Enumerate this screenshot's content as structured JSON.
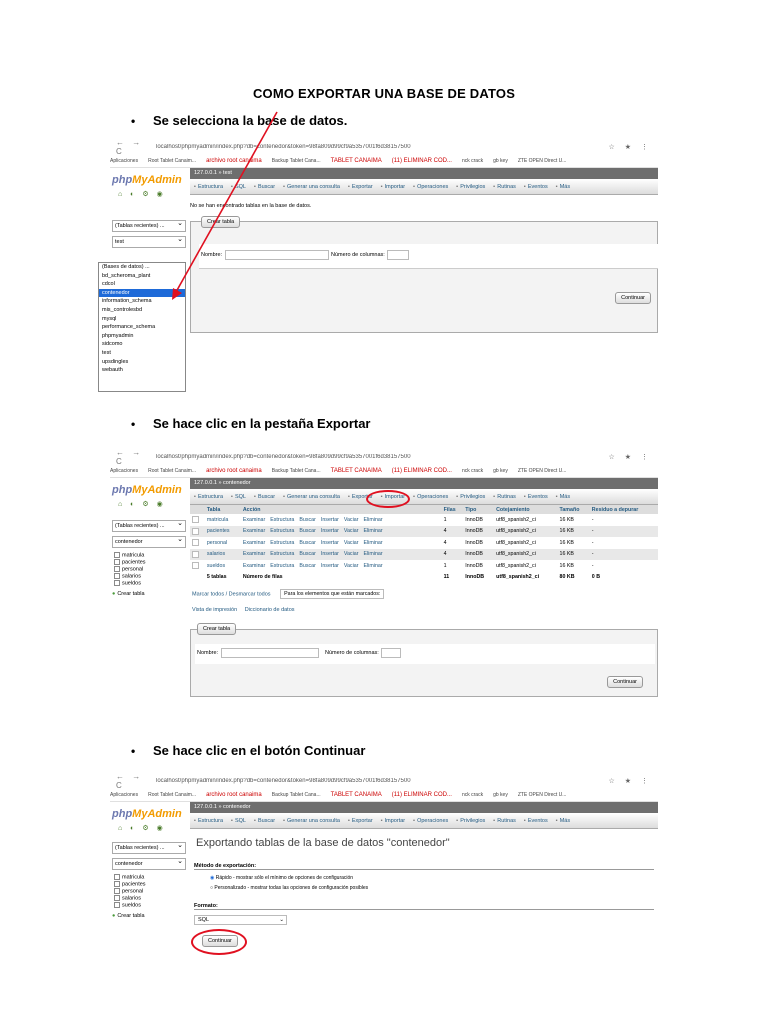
{
  "document": {
    "title": "COMO EXPORTAR UNA BASE DE DATOS",
    "steps": [
      "Se selecciona la base de datos.",
      "Se hace clic en la pestaña Exportar",
      "Se hace clic en el botón Continuar"
    ],
    "bullet": "•"
  },
  "browser": {
    "url1": "localhost/phpmyadmin/index.php?db=contenedor&token=98fa809d99cf9a5357001f6d38157500",
    "url2": "localhost/phpmyadmin/index.php?db=contenedor&token=98fa809d99cf9a5357001f6d38157500",
    "url3": "localhost/phpmyadmin/index.php?db=contenedor&token=98fa809d99cf9a5357001f6d38157500",
    "nav": "← → C",
    "tools": "☆ ★ ⋮",
    "bookmarks": [
      "Aplicaciones",
      "Root Tablet Canaim...",
      "archivo root canaima",
      "Backup Tablet Cana...",
      "TABLET CANAIMA",
      "(11) ELIMINAR COD...",
      "nck crack",
      "gb key",
      "ZTE OPEN Direct U..."
    ]
  },
  "pma": {
    "logo_php": "php",
    "logo_my": "MyAdmin",
    "recent": "(Tablas recientes) ...",
    "crumb1": "127.0.0.1 » test",
    "crumb2": "127.0.0.1 » contenedor",
    "tabs": [
      "Estructura",
      "SQL",
      "Buscar",
      "Generar una consulta",
      "Exportar",
      "Importar",
      "Operaciones",
      "Privilegios",
      "Rutinas",
      "Eventos",
      "Más"
    ],
    "db_selected_1": "test",
    "db_selected_2": "contenedor",
    "db_list": [
      "(Bases de datos) ...",
      "bd_scheroma_plant",
      "cdcol",
      "contenedor",
      "information_schema",
      "mis_controlesbd",
      "mysql",
      "performance_schema",
      "phpmyadmin",
      "sidcomo",
      "test",
      "upsdingles",
      "webauth"
    ],
    "db_list_selected": "contenedor",
    "tables": [
      "matricula",
      "pacientes",
      "personal",
      "salarios",
      "sueldos"
    ],
    "new_table": "Crear tabla",
    "no_tables": "No se han encontrado tablas en la base de datos.",
    "create_table_legend": "Crear tabla",
    "name_label": "Nombre:",
    "cols_label": "Número de columnas:",
    "continue_btn": "Continuar"
  },
  "shot2": {
    "headers": [
      "Tabla",
      "Acción",
      "Filas",
      "Tipo",
      "Cotejamiento",
      "Tamaño",
      "Residuo a depurar"
    ],
    "actions": [
      "Examinar",
      "Estructura",
      "Buscar",
      "Insertar",
      "Vaciar",
      "Eliminar"
    ],
    "rows": [
      {
        "name": "matricula",
        "rows": "1",
        "type": "InnoDB",
        "coll": "utf8_spanish2_ci",
        "size": "16 KB",
        "overhead": "-"
      },
      {
        "name": "pacientes",
        "rows": "4",
        "type": "InnoDB",
        "coll": "utf8_spanish2_ci",
        "size": "16 KB",
        "overhead": "-"
      },
      {
        "name": "personal",
        "rows": "4",
        "type": "InnoDB",
        "coll": "utf8_spanish2_ci",
        "size": "16 KB",
        "overhead": "-"
      },
      {
        "name": "salarios",
        "rows": "4",
        "type": "InnoDB",
        "coll": "utf8_spanish2_ci",
        "size": "16 KB",
        "overhead": "-"
      },
      {
        "name": "sueldos",
        "rows": "1",
        "type": "InnoDB",
        "coll": "utf8_spanish2_ci",
        "size": "16 KB",
        "overhead": "-"
      }
    ],
    "total": {
      "name": "5 tablas",
      "label": "Número de filas",
      "rows": "11",
      "type": "InnoDB",
      "coll": "utf8_spanish2_ci",
      "size": "80 KB",
      "overhead": "0 B"
    },
    "check_all": "Marcar todos / Desmarcar todos",
    "with_selected": "Para los elementos que están marcados:",
    "print_view": "Vista de impresión",
    "dictionary": "Diccionario de datos"
  },
  "shot3": {
    "heading": "Exportando tablas de la base de datos \"contenedor\"",
    "method_label": "Método de exportación:",
    "quick": "Rápido - mostrar sólo el mínimo de opciones de configuración",
    "custom": "Personalizado - mostrar todas las opciones de configuración posibles",
    "format_label": "Formato:",
    "format_value": "SQL"
  },
  "colors": {
    "accent_red": "#e01020",
    "pma_blue": "#235a81"
  }
}
